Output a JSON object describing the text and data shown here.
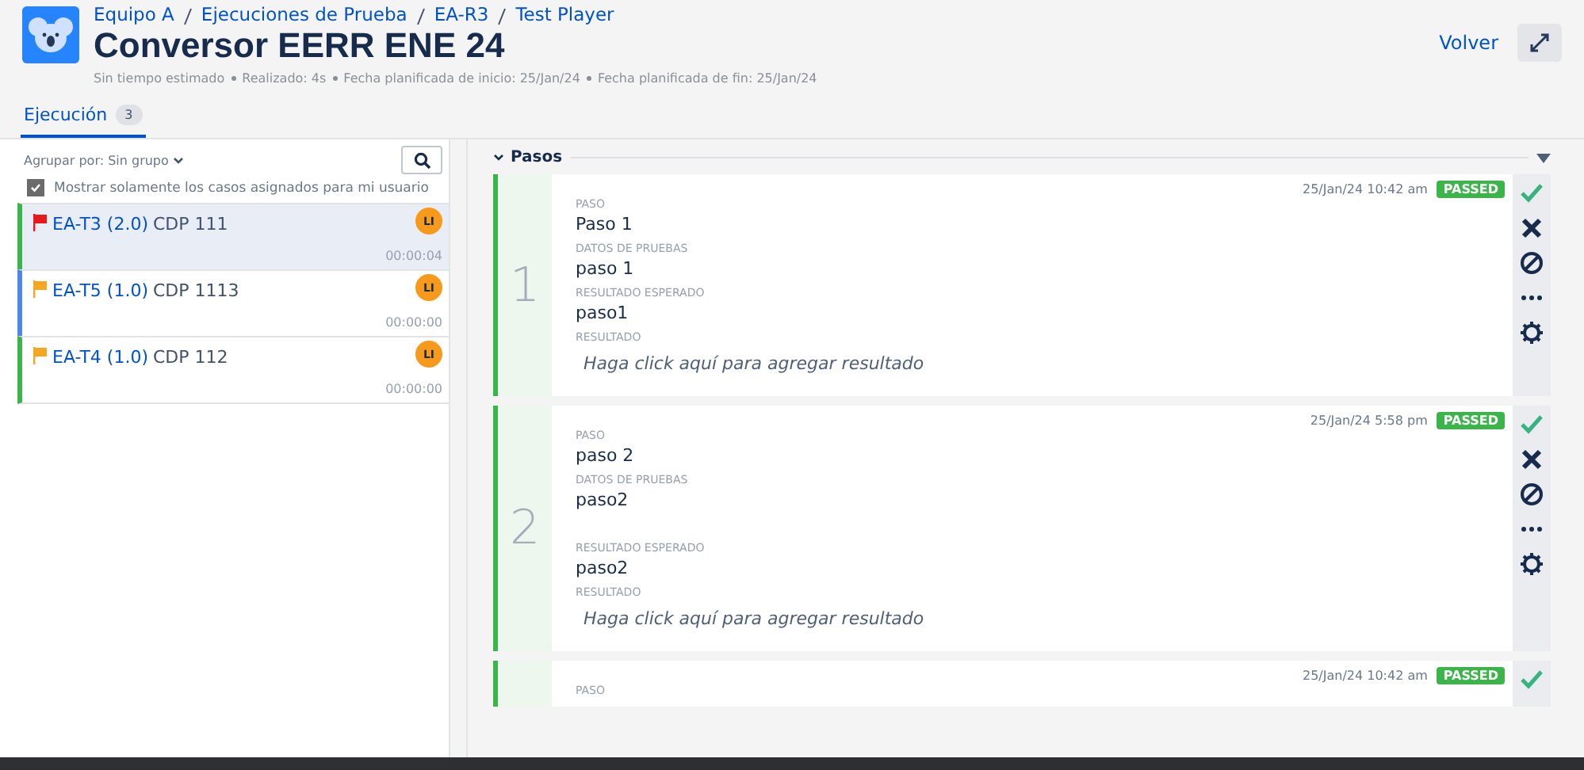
{
  "breadcrumbs": [
    "Equipo A",
    "Ejecuciones de Prueba",
    "EA-R3",
    "Test Player"
  ],
  "title": "Conversor EERR ENE 24",
  "meta": [
    "Sin tiempo estimado",
    "Realizado: 4s",
    "Fecha planificada de inicio: 25/Jan/24",
    "Fecha planificada de fin: 25/Jan/24"
  ],
  "back_link": "Volver",
  "tabs": [
    {
      "label": "Ejecución",
      "count": "3",
      "selected": true
    }
  ],
  "group_by": "Agrupar por: Sin grupo",
  "only_mine": {
    "label": "Mostrar solamente los casos asignados para mi usuario",
    "checked": true
  },
  "cases": [
    {
      "key": "EA-T3 (2.0)",
      "name": "CDP 111",
      "avatar": "LI",
      "time": "00:00:04",
      "color": "#3bb54a",
      "flag": {
        "color": "#e8191a"
      },
      "selected": true
    },
    {
      "key": "EA-T5 (1.0)",
      "name": "CDP 1113",
      "avatar": "LI",
      "time": "00:00:00",
      "color": "#4c86e6",
      "flag": {
        "color": "#f5a623"
      },
      "selected": false
    },
    {
      "key": "EA-T4 (1.0)",
      "name": "CDP 112",
      "avatar": "LI",
      "time": "00:00:00",
      "color": "#3bb54a",
      "flag": {
        "color": "#f5a623"
      },
      "selected": false
    }
  ],
  "section": {
    "title": "Pasos",
    "expanded": true
  },
  "steps": [
    {
      "number": "1",
      "date": "25/Jan/24 10:42 am",
      "status": "PASSED",
      "fields": [
        {
          "label": "PASO",
          "value": "Paso 1"
        },
        {
          "label": "DATOS DE PRUEBAS",
          "value": "paso 1"
        },
        {
          "label": "RESULTADO ESPERADO",
          "value": "paso1"
        },
        {
          "label": "RESULTADO",
          "placeholder": "Haga click aquí para agregar resultado"
        }
      ],
      "actions": [
        {
          "kind": "pass"
        },
        {
          "kind": "fail"
        },
        {
          "kind": "block"
        },
        {
          "kind": "more"
        },
        {
          "kind": "settings"
        }
      ]
    },
    {
      "number": "2",
      "date": "25/Jan/24 5:58 pm",
      "status": "PASSED",
      "fields": [
        {
          "label": "PASO",
          "value": "paso 2"
        },
        {
          "label": "DATOS DE PRUEBAS",
          "value": "paso2"
        },
        {
          "label": "RESULTADO ESPERADO",
          "value": "paso2"
        },
        {
          "label": "RESULTADO",
          "placeholder": "Haga click aquí para agregar resultado"
        }
      ],
      "actions": [
        {
          "kind": "pass"
        },
        {
          "kind": "fail"
        },
        {
          "kind": "block"
        },
        {
          "kind": "more"
        },
        {
          "kind": "settings"
        }
      ]
    },
    {
      "date": "25/Jan/24 10:42 am",
      "status": "PASSED",
      "fields": [
        {
          "label": "PASO"
        }
      ],
      "actions": [
        {
          "kind": "pass"
        }
      ]
    }
  ]
}
